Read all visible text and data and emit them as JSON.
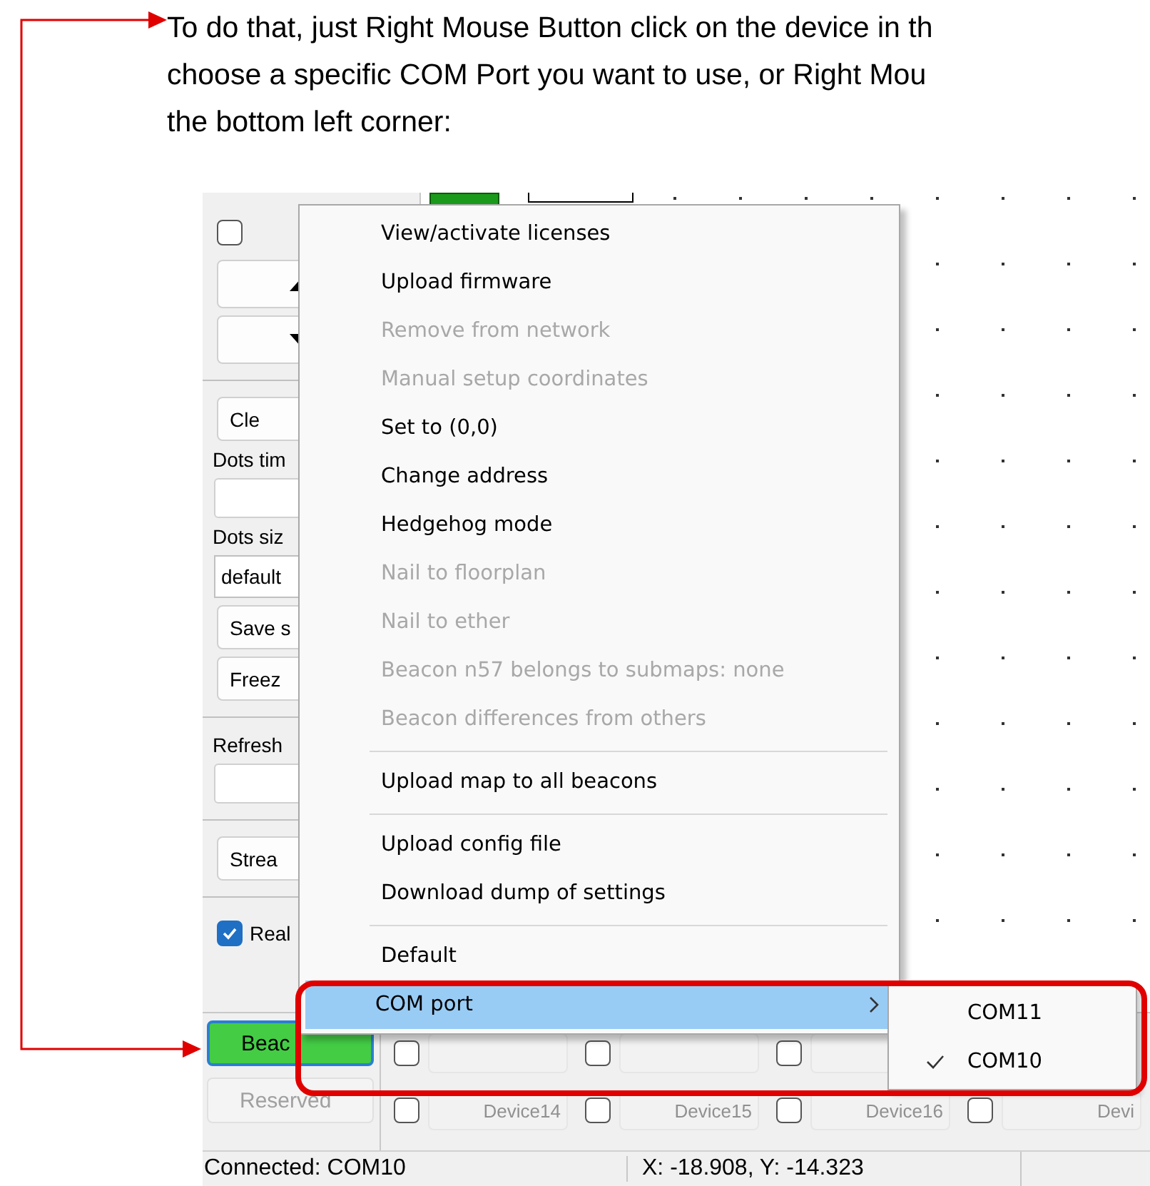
{
  "instruction_text": [
    "To do that, just Right Mouse Button click on the device in th",
    "choose a specific COM Port you want to use, or Right Mou",
    "the bottom left corner:"
  ],
  "left_panel": [
    {
      "kind": "checkbox",
      "checked": false
    },
    {
      "kind": "up_button"
    },
    {
      "kind": "down_button"
    },
    {
      "kind": "separator"
    },
    {
      "kind": "button",
      "label": "Cle"
    },
    {
      "kind": "label",
      "text": "Dots tim"
    },
    {
      "kind": "field"
    },
    {
      "kind": "label",
      "text": "Dots siz"
    },
    {
      "kind": "select",
      "value": "default"
    },
    {
      "kind": "button",
      "label": "Save s"
    },
    {
      "kind": "button",
      "label": "Freez"
    },
    {
      "kind": "separator"
    },
    {
      "kind": "label",
      "text": "Refresh"
    },
    {
      "kind": "field"
    },
    {
      "kind": "separator"
    },
    {
      "kind": "button",
      "label": "Strea"
    },
    {
      "kind": "separator"
    },
    {
      "kind": "checkbox",
      "checked": true,
      "label": "Real"
    }
  ],
  "device_buttons": [
    {
      "label": "Beac",
      "active": true
    },
    {
      "label": "Reserved",
      "active": false
    }
  ],
  "devices": [
    {
      "cells": [
        {
          "checked": false
        },
        {
          "checked": false
        },
        {
          "checked": false
        }
      ]
    },
    {
      "cells": [
        {
          "label": "Device14",
          "checked": false
        },
        {
          "label": "Device15",
          "checked": false
        },
        {
          "label": "Device16",
          "checked": false
        },
        {
          "label": "Devi",
          "checked": false
        }
      ]
    }
  ],
  "status_bar": {
    "connection": "Connected: COM10",
    "coordinates": "X: -18.908, Y: -14.323"
  },
  "context_menu": {
    "items": [
      {
        "kind": "item",
        "label": "View/activate licenses",
        "disabled": false,
        "selected": false
      },
      {
        "kind": "item",
        "label": "Upload firmware",
        "disabled": false,
        "selected": false
      },
      {
        "kind": "item",
        "label": "Remove from network",
        "disabled": true,
        "selected": false
      },
      {
        "kind": "item",
        "label": "Manual setup coordinates",
        "disabled": true,
        "selected": false
      },
      {
        "kind": "item",
        "label": "Set to (0,0)",
        "disabled": false,
        "selected": false
      },
      {
        "kind": "item",
        "label": "Change address",
        "disabled": false,
        "selected": false
      },
      {
        "kind": "item",
        "label": "Hedgehog mode",
        "disabled": false,
        "selected": false
      },
      {
        "kind": "item",
        "label": "Nail to floorplan",
        "disabled": true,
        "selected": false
      },
      {
        "kind": "item",
        "label": "Nail to ether",
        "disabled": true,
        "selected": false
      },
      {
        "kind": "item",
        "label": "Beacon n57 belongs to submaps: none",
        "disabled": true,
        "selected": false
      },
      {
        "kind": "item",
        "label": "Beacon differences from others",
        "disabled": true,
        "selected": false
      },
      {
        "kind": "separator"
      },
      {
        "kind": "item",
        "label": "Upload map to all beacons",
        "disabled": false,
        "selected": false
      },
      {
        "kind": "separator"
      },
      {
        "kind": "item",
        "label": "Upload config file",
        "disabled": false,
        "selected": false
      },
      {
        "kind": "item",
        "label": "Download dump of settings",
        "disabled": false,
        "selected": false
      },
      {
        "kind": "separator"
      },
      {
        "kind": "item",
        "label": "Default",
        "disabled": false,
        "selected": false
      },
      {
        "kind": "submenu",
        "label": "COM port",
        "disabled": false,
        "selected": true
      }
    ],
    "submenu": {
      "items": [
        {
          "label": "COM11",
          "checked": false
        },
        {
          "label": "COM10",
          "checked": true
        }
      ]
    }
  }
}
